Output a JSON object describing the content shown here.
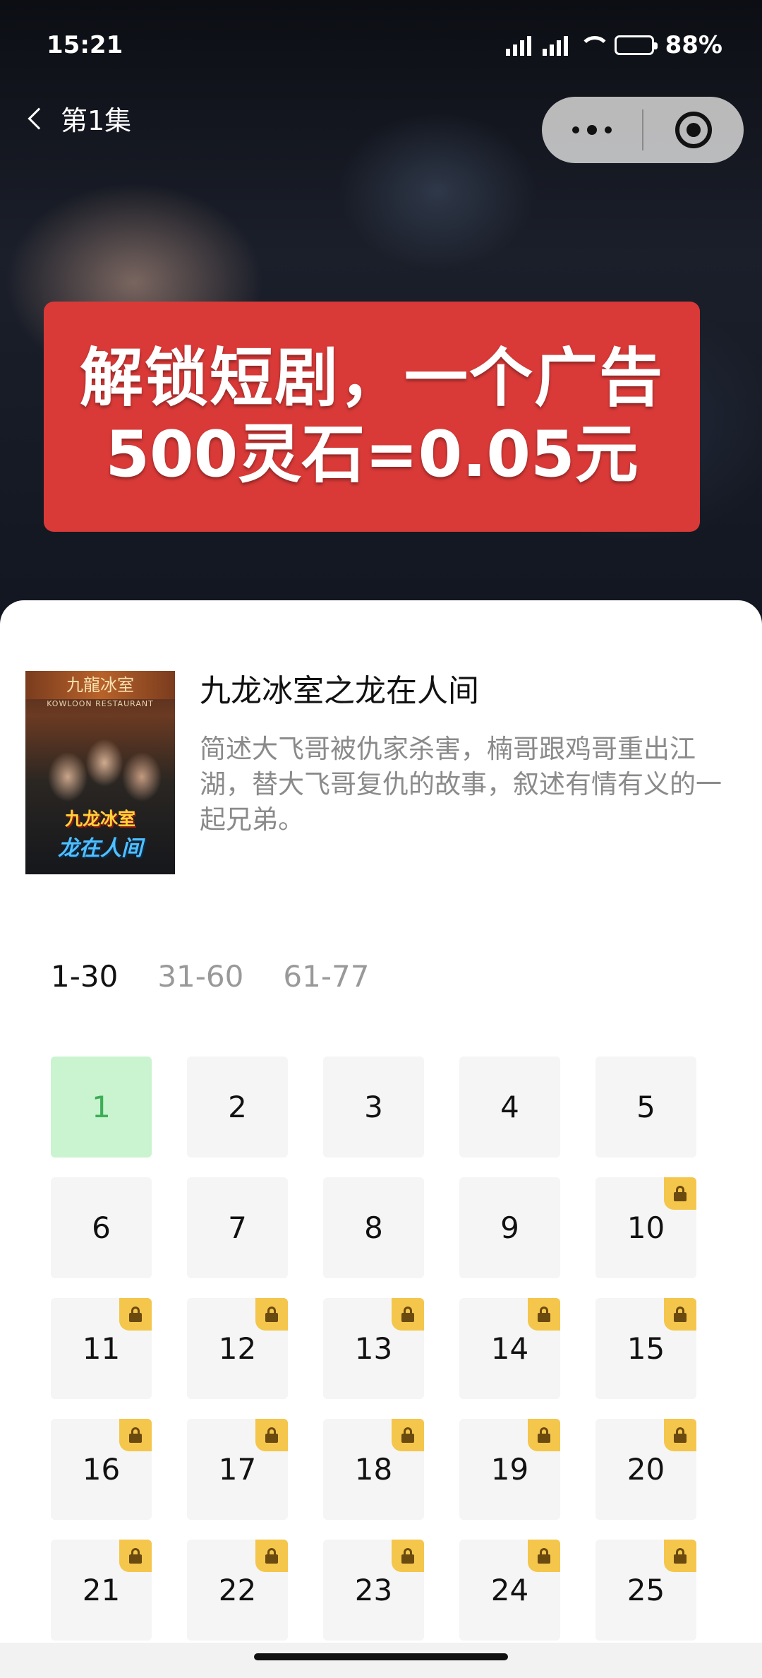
{
  "status_bar": {
    "time": "15:21",
    "battery": "88%",
    "battery_level": 0.88
  },
  "nav": {
    "title": "第1集",
    "icons": {
      "back": "chevron-left-icon",
      "more": "more-dots-icon",
      "close": "target-icon"
    }
  },
  "promo": {
    "line1": "解锁短剧，一个广告",
    "line2": "500灵石=0.05元",
    "color": "#d93a38"
  },
  "drama": {
    "poster": {
      "top_text": "九龍冰室",
      "sub_text": "KOWLOON RESTAURANT",
      "title_line1": "九龙冰室",
      "title_line2": "龙在人间"
    },
    "title": "九龙冰室之龙在人间",
    "description": "简述大飞哥被仇家杀害，楠哥跟鸡哥重出江湖，替大飞哥复仇的故事，叙述有情有义的一起兄弟。"
  },
  "tabs": [
    {
      "label": "1-30",
      "active": true
    },
    {
      "label": "31-60",
      "active": false
    },
    {
      "label": "61-77",
      "active": false
    }
  ],
  "episodes": [
    {
      "label": "1",
      "locked": false,
      "current": true
    },
    {
      "label": "2",
      "locked": false
    },
    {
      "label": "3",
      "locked": false
    },
    {
      "label": "4",
      "locked": false
    },
    {
      "label": "5",
      "locked": false
    },
    {
      "label": "6",
      "locked": false
    },
    {
      "label": "7",
      "locked": false
    },
    {
      "label": "8",
      "locked": false
    },
    {
      "label": "9",
      "locked": false
    },
    {
      "label": "10",
      "locked": true
    },
    {
      "label": "11",
      "locked": true
    },
    {
      "label": "12",
      "locked": true
    },
    {
      "label": "13",
      "locked": true
    },
    {
      "label": "14",
      "locked": true
    },
    {
      "label": "15",
      "locked": true
    },
    {
      "label": "16",
      "locked": true
    },
    {
      "label": "17",
      "locked": true
    },
    {
      "label": "18",
      "locked": true
    },
    {
      "label": "19",
      "locked": true
    },
    {
      "label": "20",
      "locked": true
    },
    {
      "label": "21",
      "locked": true
    },
    {
      "label": "22",
      "locked": true
    },
    {
      "label": "23",
      "locked": true
    },
    {
      "label": "24",
      "locked": true
    },
    {
      "label": "25",
      "locked": true
    }
  ],
  "colors": {
    "current_episode_bg": "#c9f4cf",
    "current_episode_text": "#3cae57",
    "lock_badge": "#f4c64c"
  }
}
